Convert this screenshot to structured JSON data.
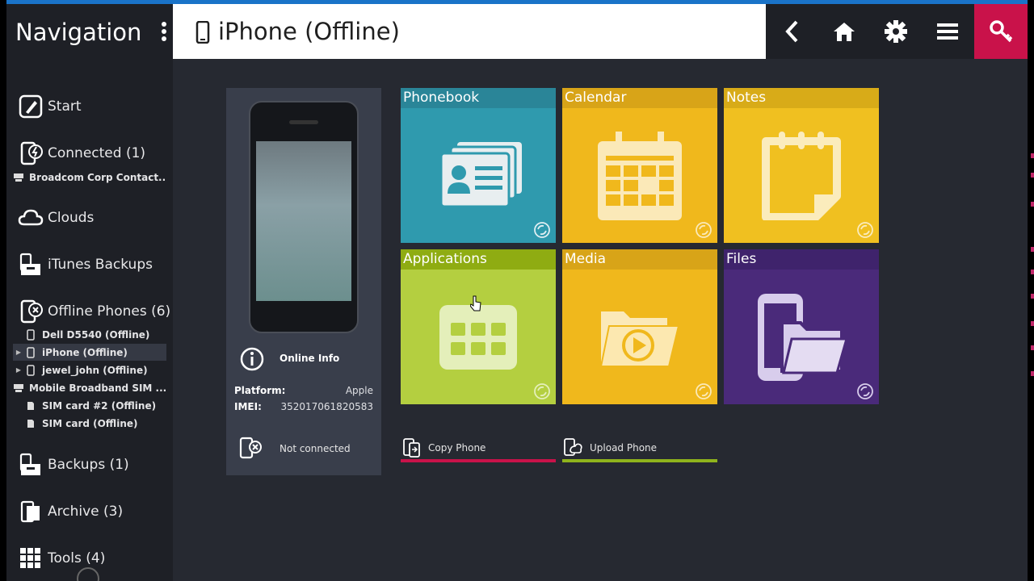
{
  "nav": {
    "title": "Navigation",
    "items": [
      {
        "id": "start",
        "label": "Start"
      },
      {
        "id": "connected",
        "label": "Connected (1)"
      },
      {
        "id": "clouds",
        "label": "Clouds"
      },
      {
        "id": "itunes",
        "label": "iTunes Backups"
      },
      {
        "id": "offline",
        "label": "Offline Phones (6)"
      },
      {
        "id": "backups",
        "label": "Backups (1)"
      },
      {
        "id": "archive",
        "label": "Archive (3)"
      },
      {
        "id": "tools",
        "label": "Tools (4)"
      }
    ],
    "connected_children": [
      "Broadcom Corp Contact..."
    ],
    "offline_children": [
      "Dell D5540 (Offline)",
      "iPhone (Offline)",
      "jewel_john (Offline)",
      "Mobile Broadband SIM ...",
      "SIM card #2 (Offline)",
      "SIM card (Offline)"
    ],
    "selected_offline": "iPhone (Offline)"
  },
  "header": {
    "title": "iPhone (Offline)",
    "buttons": [
      "back-arrow-icon",
      "home-icon",
      "gear-icon",
      "hamburger-menu-icon",
      "key-icon"
    ]
  },
  "device": {
    "online_info": "Online Info",
    "platform_label": "Platform:",
    "platform_value": "Apple",
    "imei_label": "IMEI:",
    "imei_value": "352017061820583",
    "status": "Not connected"
  },
  "tiles": [
    {
      "label": "Phonebook",
      "color": "#2f9aae",
      "header": "#2a8598",
      "icon": "contact-cards-icon"
    },
    {
      "label": "Calendar",
      "color": "#f0b81c",
      "header": "#d8a418",
      "icon": "calendar-icon"
    },
    {
      "label": "Notes",
      "color": "#f0c020",
      "header": "#d8ab18",
      "icon": "notepad-icon"
    },
    {
      "label": "Applications",
      "color": "#b4cf40",
      "header": "#8fac12",
      "icon": "app-grid-icon"
    },
    {
      "label": "Media",
      "color": "#f0b81c",
      "header": "#d8a418",
      "icon": "media-folder-icon"
    },
    {
      "label": "Files",
      "color": "#4a2a7a",
      "header": "#3f236c",
      "icon": "phone-folder-icon"
    }
  ],
  "actions": [
    {
      "label": "Copy Phone",
      "color": "#c9124a"
    },
    {
      "label": "Upload Phone",
      "color": "#8fb31c"
    }
  ],
  "colors": {
    "accent": "#1a73c8",
    "key_button": "#c9124a",
    "sidebar": "#1e2026",
    "content": "#262931"
  }
}
